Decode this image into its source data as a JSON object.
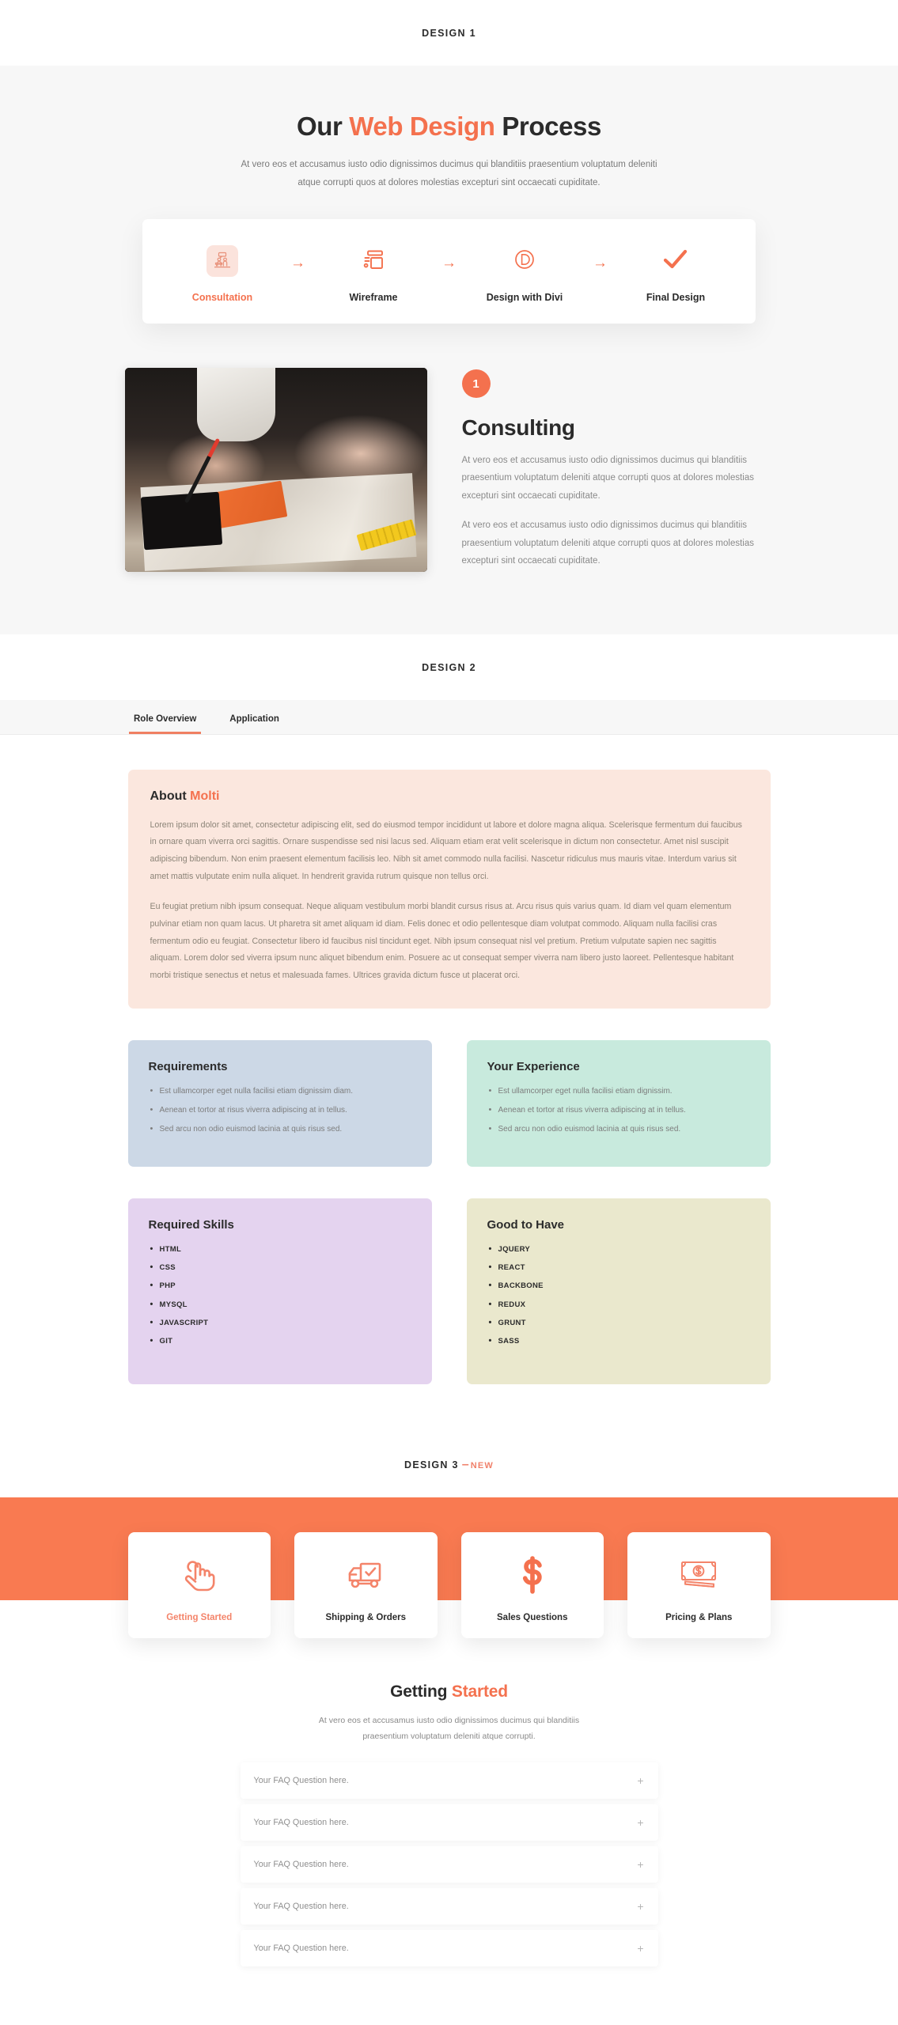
{
  "design1": {
    "section_label": "DESIGN 1",
    "title_before": "Our ",
    "title_highlight": "Web Design",
    "title_after": " Process",
    "subtitle_line1": "At vero eos et accusamus iusto odio dignissimos ducimus qui blanditiis praesentium voluptatum deleniti",
    "subtitle_line2": "atque corrupti quos at dolores molestias excepturi sint occaecati cupiditate.",
    "steps": [
      {
        "label": "Consultation",
        "icon": "consultation-icon",
        "active": true
      },
      {
        "label": "Wireframe",
        "icon": "wireframe-icon",
        "active": false
      },
      {
        "label": "Design with Divi",
        "icon": "divi-logo-icon",
        "active": false
      },
      {
        "label": "Final Design",
        "icon": "checkmark-icon",
        "active": false
      }
    ],
    "arrow_glyph": "→",
    "step_number": "1",
    "heading": "Consulting",
    "paragraph1": "At vero eos et accusamus iusto odio dignissimos ducimus qui blanditiis praesentium voluptatum deleniti atque corrupti quos at dolores molestias excepturi sint occaecati cupiditate.",
    "paragraph2": "At vero eos et accusamus iusto odio dignissimos ducimus qui blanditiis praesentium voluptatum deleniti atque corrupti quos at dolores molestias excepturi sint occaecati cupiditate.",
    "photo_alt": "designers sketching on paper at a table",
    "accent_color": "#f4714e",
    "background_color": "#f7f7f7"
  },
  "design2": {
    "section_label": "DESIGN 2",
    "tabs": [
      {
        "label": "Role Overview",
        "active": true
      },
      {
        "label": "Application",
        "active": false
      }
    ],
    "about": {
      "heading_before": "About ",
      "heading_highlight": "Molti",
      "paragraph1": "Lorem ipsum dolor sit amet, consectetur adipiscing elit, sed do eiusmod tempor incididunt ut labore et dolore magna aliqua. Scelerisque fermentum dui faucibus in ornare quam viverra orci sagittis. Ornare suspendisse sed nisi lacus sed. Aliquam etiam erat velit scelerisque in dictum non consectetur. Amet nisl suscipit adipiscing bibendum. Non enim praesent elementum facilisis leo. Nibh sit amet commodo nulla facilisi. Nascetur ridiculus mus mauris vitae. Interdum varius sit amet mattis vulputate enim nulla aliquet. In hendrerit gravida rutrum quisque non tellus orci.",
      "paragraph2": "Eu feugiat pretium nibh ipsum consequat. Neque aliquam vestibulum morbi blandit cursus risus at. Arcu risus quis varius quam. Id diam vel quam elementum pulvinar etiam non quam lacus. Ut pharetra sit amet aliquam id diam. Felis donec et odio pellentesque diam volutpat commodo. Aliquam nulla facilisi cras fermentum odio eu feugiat. Consectetur libero id faucibus nisl tincidunt eget. Nibh ipsum consequat nisl vel pretium. Pretium vulputate sapien nec sagittis aliquam. Lorem dolor sed viverra ipsum nunc aliquet bibendum enim. Posuere ac ut consequat semper viverra nam libero justo laoreet. Pellentesque habitant morbi tristique senectus et netus et malesuada fames. Ultrices gravida dictum fusce ut placerat orci.",
      "background_color": "#fbe7de"
    },
    "cards": [
      {
        "title": "Requirements",
        "color": "#ccd8e6",
        "style": "bullets",
        "items": [
          "Est ullamcorper eget nulla facilisi etiam dignissim diam.",
          "Aenean et tortor at risus viverra adipiscing at in tellus.",
          "Sed arcu non odio euismod lacinia at quis risus sed."
        ]
      },
      {
        "title": "Your Experience",
        "color": "#c8eadd",
        "style": "bullets",
        "items": [
          "Est ullamcorper eget nulla facilisi etiam dignissim.",
          "Aenean et tortor at risus viverra adipiscing at in tellus.",
          "Sed arcu non odio euismod lacinia at quis risus sed."
        ]
      },
      {
        "title": "Required Skills",
        "color": "#e4d3ef",
        "style": "skills",
        "items": [
          "HTML",
          "CSS",
          "PHP",
          "MYSQL",
          "JAVASCRIPT",
          "GIT"
        ]
      },
      {
        "title": "Good to Have",
        "color": "#eae8cd",
        "style": "skills",
        "items": [
          "JQUERY",
          "REACT",
          "BACKBONE",
          "REDUX",
          "GRUNT",
          "SASS"
        ]
      }
    ]
  },
  "design3": {
    "section_label": "DESIGN 3",
    "section_label_separator": "–",
    "section_label_badge": "NEW",
    "band_color": "#f97a51",
    "categories": [
      {
        "label": "Getting Started",
        "icon": "hand-click-icon",
        "active": true
      },
      {
        "label": "Shipping & Orders",
        "icon": "delivery-truck-icon",
        "active": false
      },
      {
        "label": "Sales Questions",
        "icon": "dollar-sign-icon",
        "active": false
      },
      {
        "label": "Pricing & Plans",
        "icon": "money-bills-icon",
        "active": false
      }
    ],
    "faq_title_before": "Getting ",
    "faq_title_highlight": "Started",
    "faq_sub_line1": "At vero eos et accusamus iusto odio dignissimos ducimus qui blanditiis",
    "faq_sub_line2": "praesentium voluptatum deleniti atque corrupti.",
    "faq_plus_glyph": "+",
    "faq_items": [
      {
        "question": "Your FAQ Question here."
      },
      {
        "question": "Your FAQ Question here."
      },
      {
        "question": "Your FAQ Question here."
      },
      {
        "question": "Your FAQ Question here."
      },
      {
        "question": "Your FAQ Question here."
      }
    ]
  }
}
